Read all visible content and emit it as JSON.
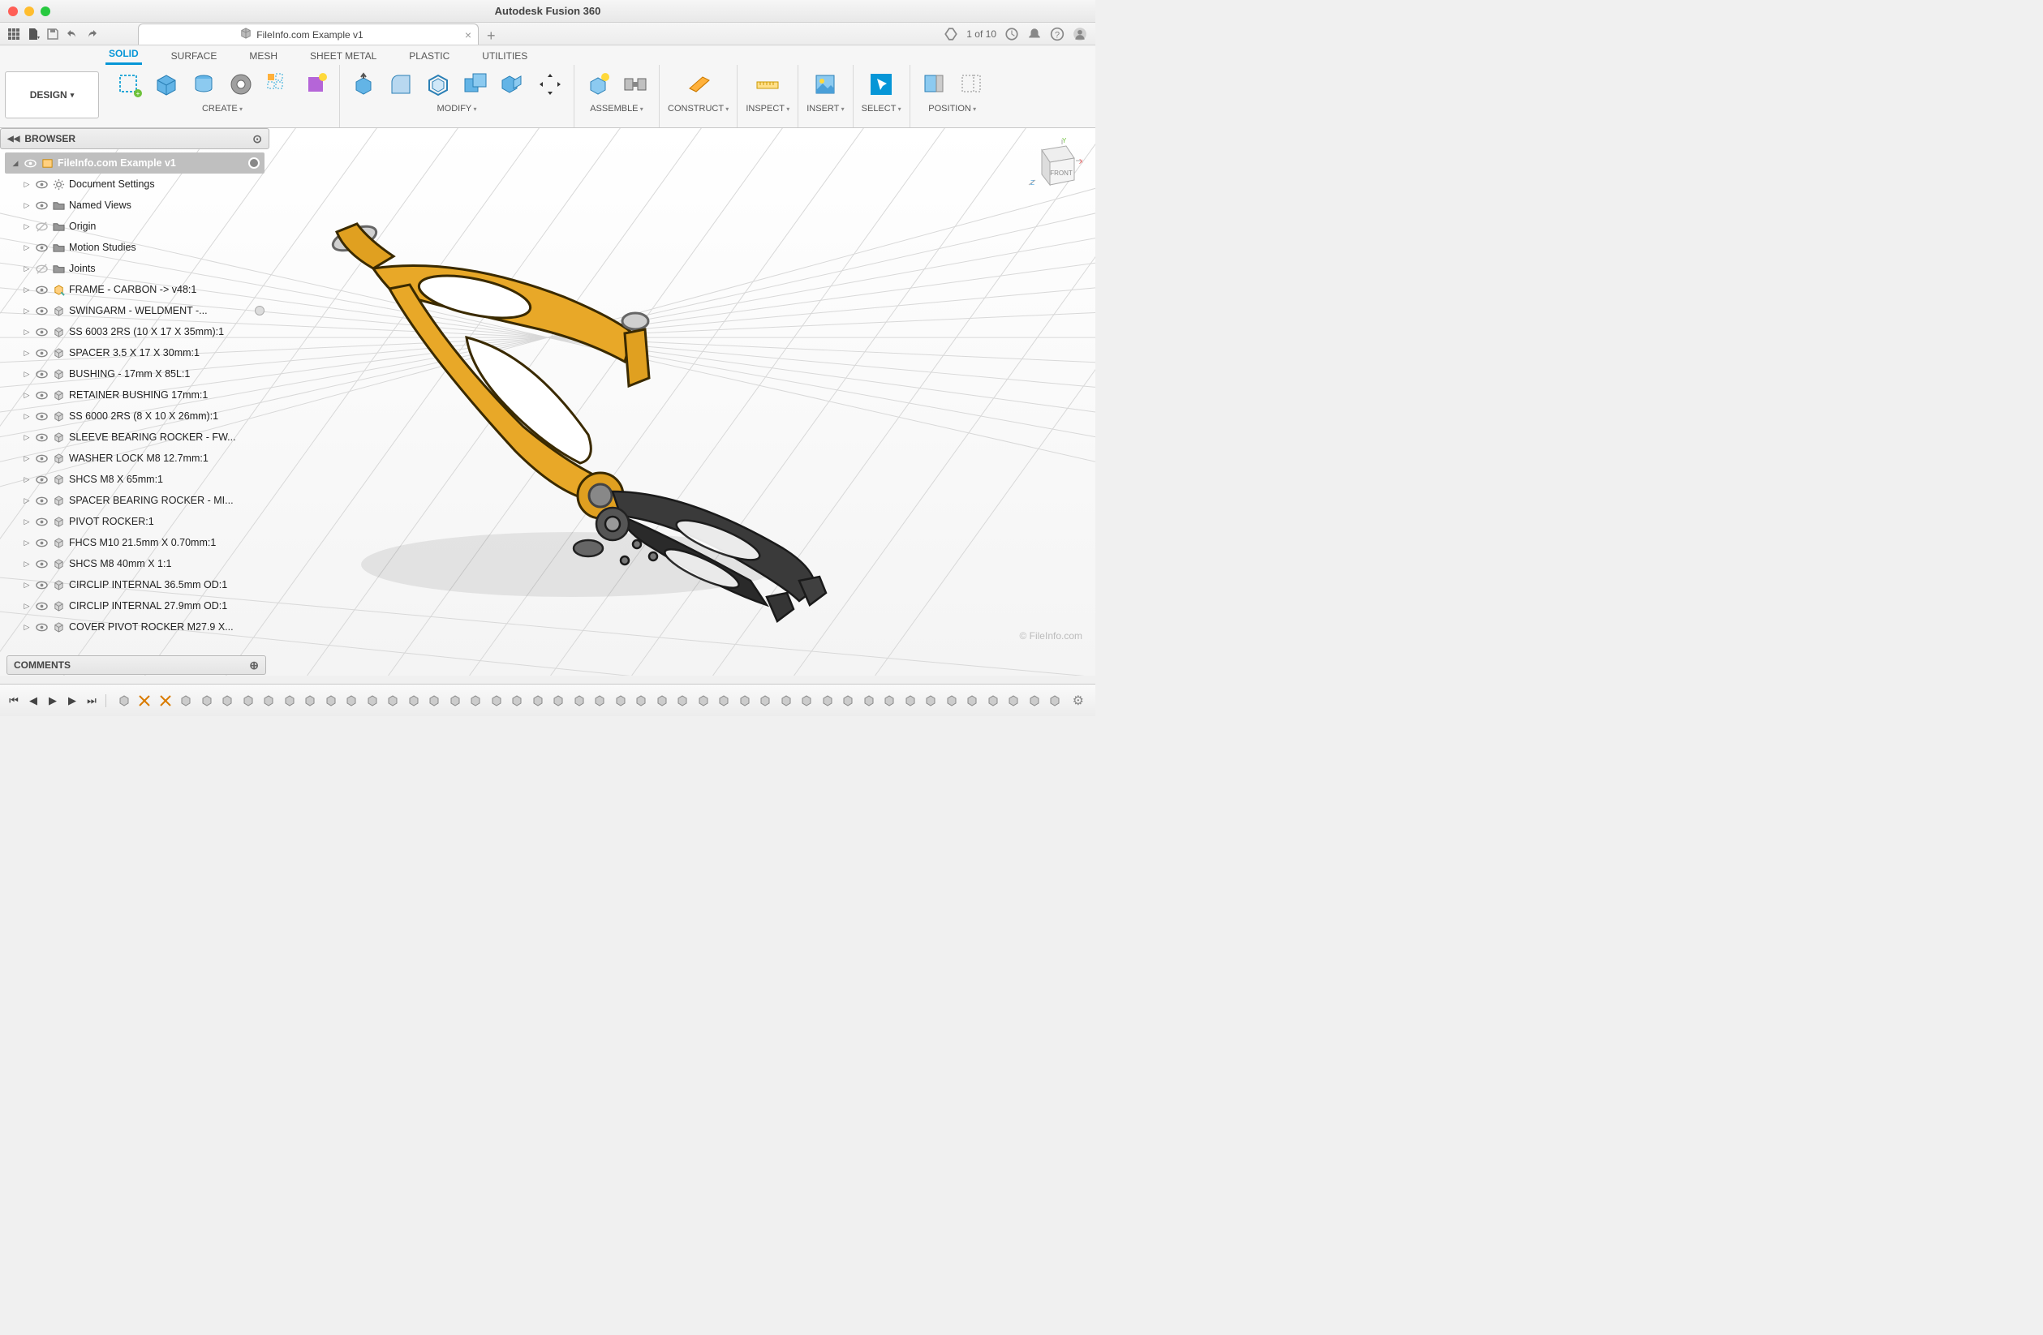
{
  "app": {
    "title": "Autodesk Fusion 360"
  },
  "qat_right": {
    "job_text": "1 of 10"
  },
  "tab": {
    "label": "FileInfo.com Example v1"
  },
  "design_button": "DESIGN",
  "ribbon_tabs": [
    "SOLID",
    "SURFACE",
    "MESH",
    "SHEET METAL",
    "PLASTIC",
    "UTILITIES"
  ],
  "ribbon_groups": {
    "create": "CREATE",
    "modify": "MODIFY",
    "assemble": "ASSEMBLE",
    "construct": "CONSTRUCT",
    "inspect": "INSPECT",
    "insert": "INSERT",
    "select": "SELECT",
    "position": "POSITION"
  },
  "browser": {
    "title": "BROWSER",
    "root": "FileInfo.com Example v1",
    "items": [
      {
        "icon": "gear",
        "label": "Document Settings"
      },
      {
        "icon": "folder",
        "label": "Named Views"
      },
      {
        "icon": "hidden",
        "label": "Origin",
        "folder": true
      },
      {
        "icon": "folder",
        "label": "Motion Studies"
      },
      {
        "icon": "hidden",
        "label": "Joints",
        "folder": true
      },
      {
        "icon": "comp-link",
        "label": "FRAME - CARBON -> v48:1"
      },
      {
        "icon": "comp",
        "label": "SWINGARM - WELDMENT -...",
        "dot": true
      },
      {
        "icon": "comp",
        "label": "SS 6003 2RS (10 X 17 X 35mm):1"
      },
      {
        "icon": "comp",
        "label": "SPACER 3.5 X 17 X 30mm:1"
      },
      {
        "icon": "comp",
        "label": "BUSHING - 17mm X 85L:1"
      },
      {
        "icon": "comp",
        "label": "RETAINER BUSHING 17mm:1"
      },
      {
        "icon": "comp",
        "label": "SS 6000 2RS (8 X 10 X 26mm):1"
      },
      {
        "icon": "comp",
        "label": "SLEEVE BEARING ROCKER - FW..."
      },
      {
        "icon": "comp",
        "label": "WASHER LOCK M8 12.7mm:1"
      },
      {
        "icon": "comp",
        "label": "SHCS M8 X 65mm:1"
      },
      {
        "icon": "comp",
        "label": "SPACER BEARING ROCKER - MI..."
      },
      {
        "icon": "comp",
        "label": "PIVOT ROCKER:1"
      },
      {
        "icon": "comp",
        "label": "FHCS M10 21.5mm X 0.70mm:1"
      },
      {
        "icon": "comp",
        "label": "SHCS M8 40mm X 1:1"
      },
      {
        "icon": "comp",
        "label": "CIRCLIP INTERNAL 36.5mm OD:1"
      },
      {
        "icon": "comp",
        "label": "CIRCLIP INTERNAL 27.9mm OD:1"
      },
      {
        "icon": "comp",
        "label": "COVER PIVOT ROCKER M27.9 X..."
      }
    ]
  },
  "comments": {
    "title": "COMMENTS"
  },
  "watermark": "© FileInfo.com",
  "viewcube": {
    "face": "FRONT"
  },
  "axes": {
    "x": "X",
    "y": "Y",
    "z": "Z"
  }
}
